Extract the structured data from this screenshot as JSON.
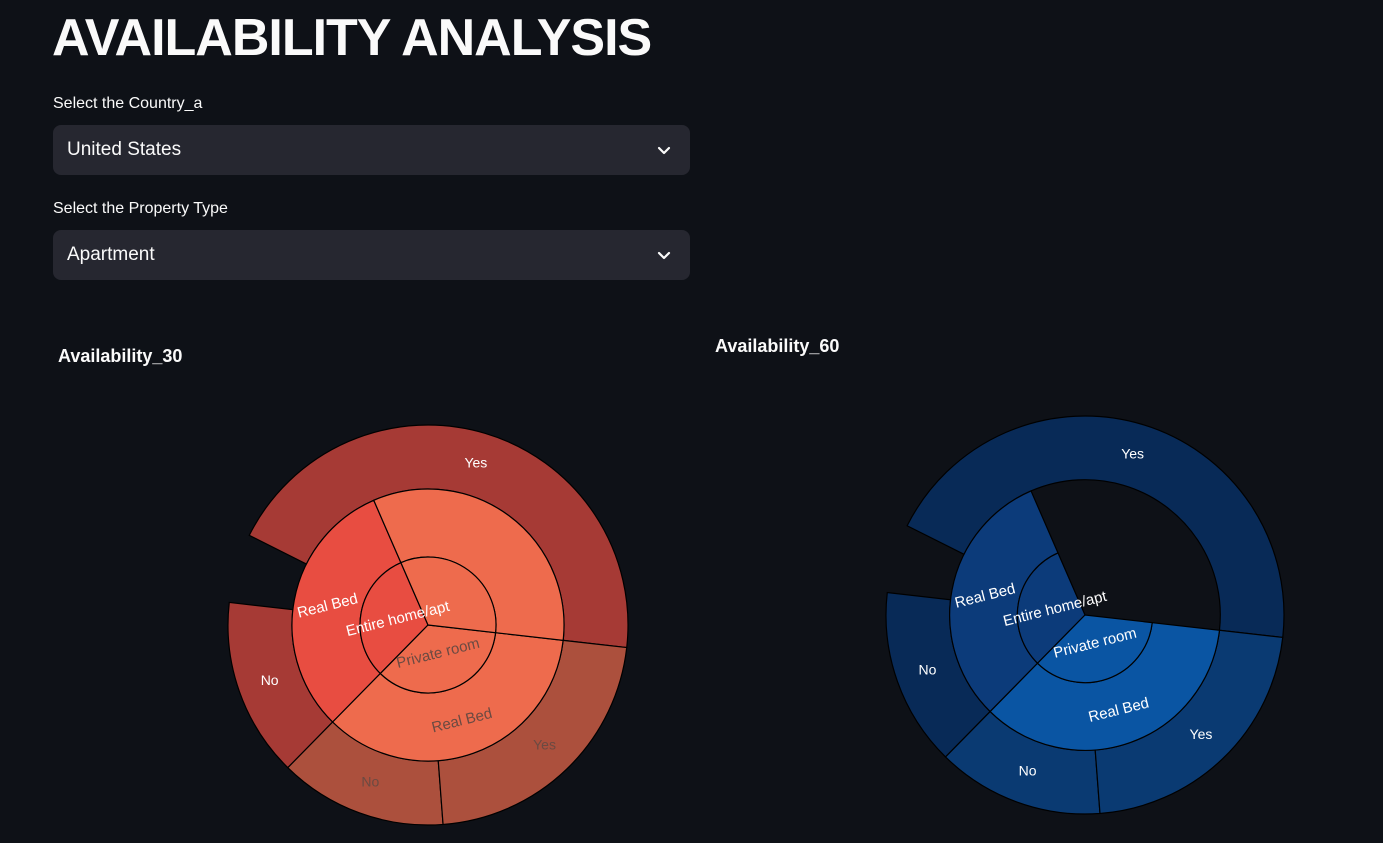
{
  "page": {
    "title": "AVAILABILITY ANALYSIS"
  },
  "filters": {
    "country": {
      "label": "Select the Country_a",
      "value": "United States",
      "icon": "chevron-down-icon"
    },
    "property": {
      "label": "Select the Property Type",
      "value": "Apartment",
      "icon": "chevron-down-icon"
    }
  },
  "chart_data": [
    {
      "type": "sunburst",
      "title": "Availability_30",
      "colors": {
        "center_top": "#e84d41",
        "center_bottom": "#ee6b4d",
        "ring_top": "#e84d41",
        "ring_bottom": "#ee6b4d",
        "outer_top": "#a63a35",
        "outer_bottom": "#ac503d",
        "line": "#000000"
      },
      "segments": [
        {
          "ring": 0,
          "label": "Entire home/apt",
          "start": 0.3333,
          "end": 0.6444,
          "color": "#e84d41",
          "label_color": "#ffffff"
        },
        {
          "ring": 0,
          "label": "Private room",
          "start": 0.6444,
          "end": 1.0,
          "color": "#ee6b4d",
          "label_color": "#6b4a42"
        },
        {
          "ring": 0,
          "label": "",
          "start": 0.0,
          "end": 0.3333,
          "color": "#ee6b4d",
          "label_color": "#ffffff"
        },
        {
          "ring": 1,
          "label": "Real Bed",
          "start": 0.3333,
          "end": 0.6444,
          "color": "#e84d41",
          "label_color": "#ffffff"
        },
        {
          "ring": 1,
          "label": "Real Bed",
          "start": 0.6444,
          "end": 1.0,
          "color": "#ee6b4d",
          "label_color": "#6b4a42"
        },
        {
          "ring": 1,
          "label": "",
          "start": 0.0,
          "end": 0.3333,
          "color": "#ee6b4d",
          "label_color": "#ffffff"
        },
        {
          "ring": 2,
          "label": "Yes",
          "start": 0.0,
          "end": 0.444,
          "color": "#a63a35",
          "label_color": "#ffffff"
        },
        {
          "ring": 2,
          "label": "No",
          "start": 0.5,
          "end": 0.6444,
          "color": "#a63a35",
          "label_color": "#ffffff"
        },
        {
          "ring": 2,
          "label": "No",
          "start": 0.6444,
          "end": 0.78,
          "color": "#ac503d",
          "label_color": "#6b4a42"
        },
        {
          "ring": 2,
          "label": "Yes",
          "start": 0.78,
          "end": 1.0,
          "color": "#ac503d",
          "label_color": "#6b4a42"
        }
      ]
    },
    {
      "type": "sunburst",
      "title": "Availability_60",
      "colors": {
        "center_top": "#0c3b7a",
        "center_bottom": "#0a55a3",
        "ring_top": "#0c3b7a",
        "ring_bottom": "#0a55a3",
        "outer_top": "#082a57",
        "outer_bottom": "#0a3a72",
        "line": "#000000"
      },
      "segments": [
        {
          "ring": 0,
          "label": "Entire home/apt",
          "start": 0.3333,
          "end": 0.6444,
          "color": "#0c3b7a",
          "label_color": "#ffffff"
        },
        {
          "ring": 0,
          "label": "Private room",
          "start": 0.6444,
          "end": 1.0,
          "color": "#0a55a3",
          "label_color": "#ffffff"
        },
        {
          "ring": 1,
          "label": "Real Bed",
          "start": 0.3333,
          "end": 0.6444,
          "color": "#0c3b7a",
          "label_color": "#ffffff"
        },
        {
          "ring": 1,
          "label": "Real Bed",
          "start": 0.6444,
          "end": 1.0,
          "color": "#0a55a3",
          "label_color": "#ffffff"
        },
        {
          "ring": 2,
          "label": "Yes",
          "start": 0.0,
          "end": 0.444,
          "color": "#082a57",
          "label_color": "#ffffff"
        },
        {
          "ring": 2,
          "label": "No",
          "start": 0.5,
          "end": 0.6444,
          "color": "#082a57",
          "label_color": "#ffffff"
        },
        {
          "ring": 2,
          "label": "No",
          "start": 0.6444,
          "end": 0.78,
          "color": "#0a3a72",
          "label_color": "#ffffff"
        },
        {
          "ring": 2,
          "label": "Yes",
          "start": 0.78,
          "end": 1.0,
          "color": "#0a3a72",
          "label_color": "#ffffff"
        }
      ]
    }
  ]
}
